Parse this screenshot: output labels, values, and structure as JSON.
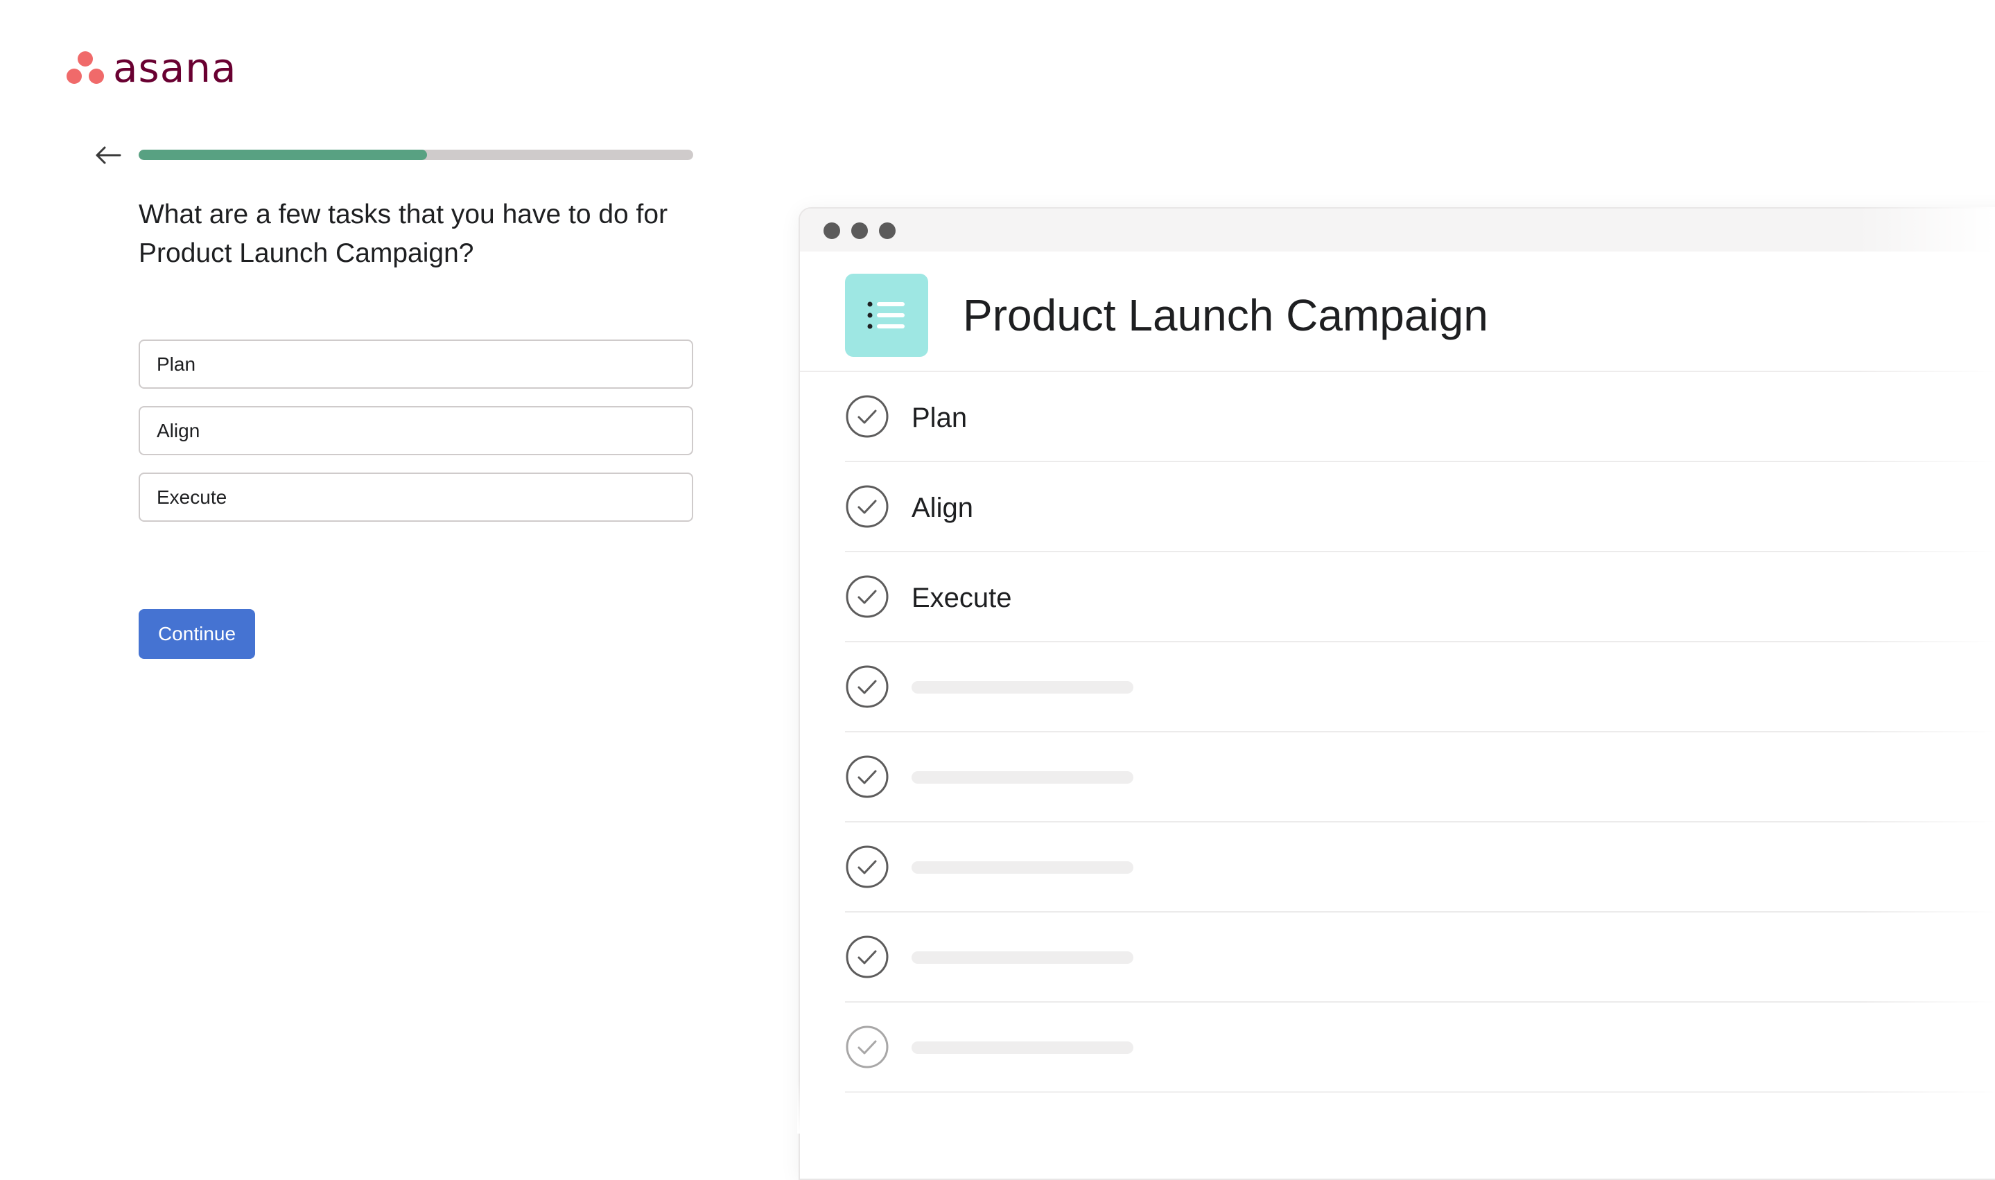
{
  "brand": {
    "name": "asana",
    "dot_color": "#f06a6a",
    "word_color": "#690031"
  },
  "onboarding": {
    "progress": 0.52,
    "question": "What are a few tasks that you have to do for Product Launch Campaign?",
    "tasks": [
      "Plan",
      "Align",
      "Execute"
    ],
    "continue_label": "Continue"
  },
  "preview": {
    "project_title": "Product Launch Campaign",
    "icon": "list-icon",
    "tasks": [
      "Plan",
      "Align",
      "Execute",
      "",
      "",
      "",
      "",
      ""
    ]
  },
  "colors": {
    "accent": "#4573d2",
    "progress": "#58a182",
    "project_icon_bg": "#9ee7e3"
  }
}
